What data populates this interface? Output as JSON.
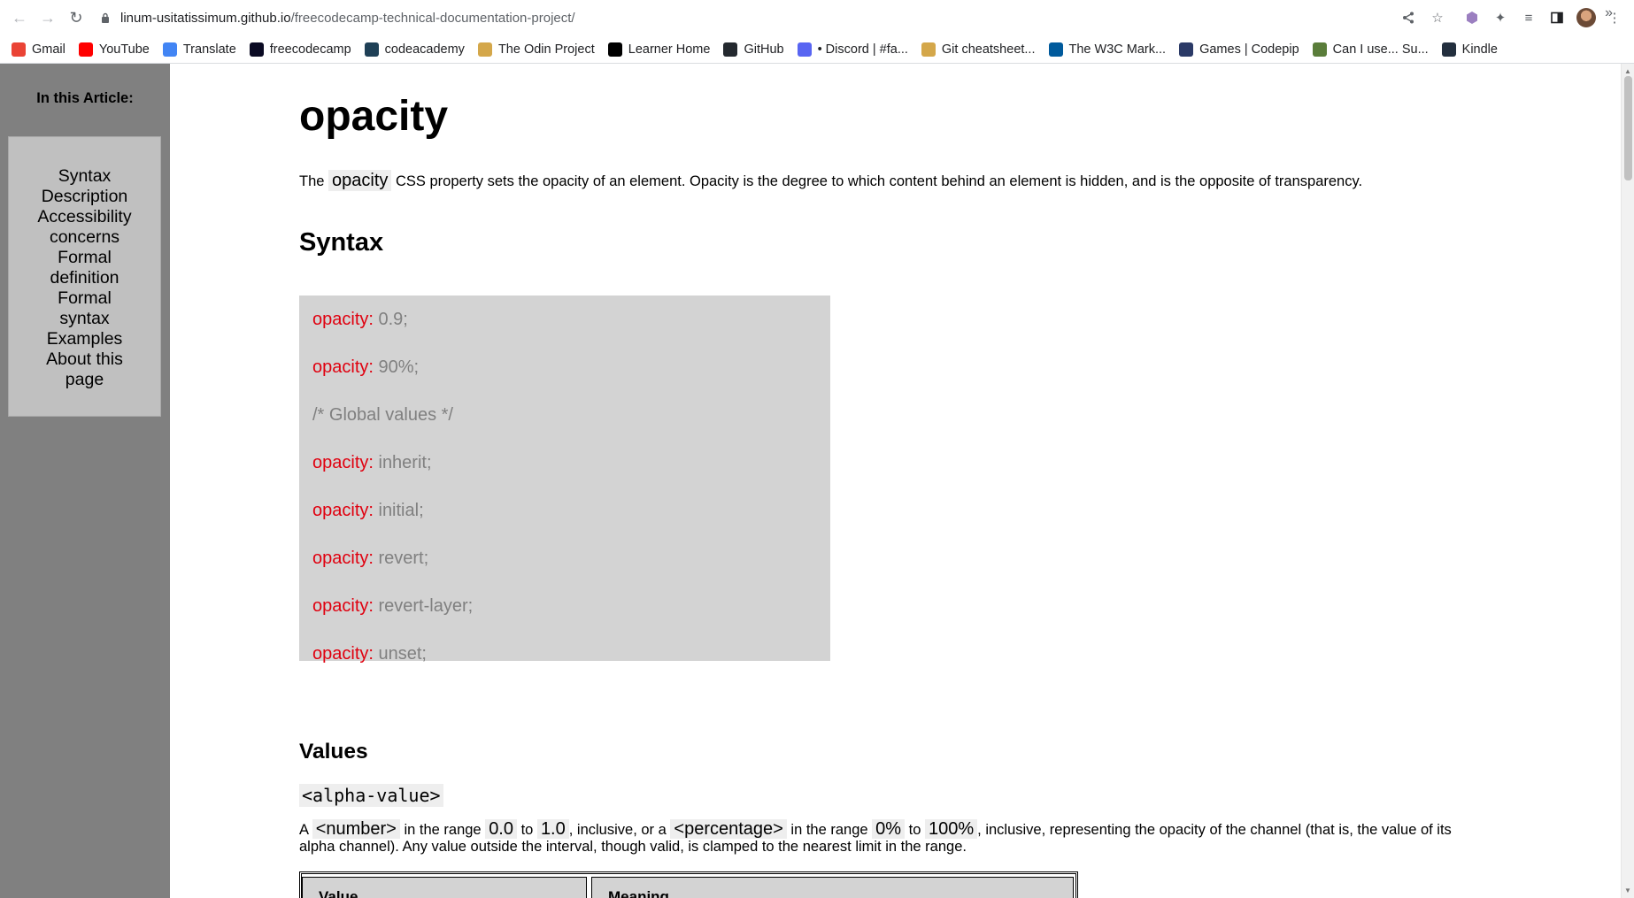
{
  "browser": {
    "url_host": "linum-usitatissimum.github.io",
    "url_path": "/freecodecamp-technical-documentation-project/",
    "bookmarks": [
      {
        "label": "Gmail",
        "color": "#ea4335",
        "icon": "gmail-icon"
      },
      {
        "label": "YouTube",
        "color": "#ff0000",
        "icon": "youtube-icon"
      },
      {
        "label": "Translate",
        "color": "#4285f4",
        "icon": "translate-icon"
      },
      {
        "label": "freecodecamp",
        "color": "#0a0a23",
        "icon": "freecodecamp-icon"
      },
      {
        "label": "codeacademy",
        "color": "#1f4056",
        "icon": "codecademy-icon"
      },
      {
        "label": "The Odin Project",
        "color": "#d4a74a",
        "icon": "odin-icon"
      },
      {
        "label": "Learner Home",
        "color": "#000000",
        "icon": "edx-icon"
      },
      {
        "label": "GitHub",
        "color": "#24292f",
        "icon": "github-icon"
      },
      {
        "label": "• Discord | #fa...",
        "color": "#5865f2",
        "icon": "discord-icon"
      },
      {
        "label": "Git cheatsheet...",
        "color": "#d4a74a",
        "icon": "odin-icon"
      },
      {
        "label": "The W3C Mark...",
        "color": "#005a9c",
        "icon": "w3c-icon"
      },
      {
        "label": "Games | Codepip",
        "color": "#2b3a67",
        "icon": "codepip-icon"
      },
      {
        "label": "Can I use... Su...",
        "color": "#5a7d3a",
        "icon": "caniuse-icon"
      },
      {
        "label": "Kindle",
        "color": "#232f3e",
        "icon": "kindle-icon"
      }
    ],
    "bookmarks_overflow": "»"
  },
  "sidebar": {
    "title": "In this Article:",
    "items": [
      {
        "label": "Syntax"
      },
      {
        "label": "Description"
      },
      {
        "label": "Accessibility concerns"
      },
      {
        "label": "Formal definition"
      },
      {
        "label": "Formal syntax"
      },
      {
        "label": "Examples"
      },
      {
        "label": "About this page"
      }
    ]
  },
  "main": {
    "title": "opacity",
    "intro_before": "The ",
    "intro_code": "opacity",
    "intro_after": " CSS property sets the opacity of an element. Opacity is the degree to which content behind an element is hidden, and is the opposite of transparency.",
    "syntax_heading": "Syntax",
    "code_lines": [
      {
        "prop": "opacity:",
        "val": " 0.9;"
      },
      {
        "prop": "opacity:",
        "val": " 90%;"
      },
      {
        "prop": "",
        "val": "/* Global values */"
      },
      {
        "prop": "opacity:",
        "val": " inherit;"
      },
      {
        "prop": "opacity:",
        "val": " initial;"
      },
      {
        "prop": "opacity:",
        "val": " revert;"
      },
      {
        "prop": "opacity:",
        "val": " revert-layer;"
      },
      {
        "prop": "opacity:",
        "val": " unset;"
      }
    ],
    "values_heading": "Values",
    "alpha_value": "<alpha-value>",
    "alpha_desc": {
      "t1": "A ",
      "c1": "<number>",
      "t2": " in the range ",
      "c2": "0.0",
      "t3": " to ",
      "c3": "1.0",
      "t4": ", inclusive, or a ",
      "c4": "<percentage>",
      "t5": " in the range ",
      "c5": "0%",
      "t6": " to ",
      "c6": "100%",
      "t7": ", inclusive, representing the opacity of the channel (that is, the value of its alpha channel). Any value outside the interval, though valid, is clamped to the nearest limit in the range."
    },
    "table_headers": [
      "Value",
      "Meaning"
    ]
  },
  "colors": {
    "sidebar_bg": "#808080",
    "toc_bg": "#c0c0c0",
    "code_bg": "#d3d3d3",
    "code_prop": "#e0000f",
    "code_val": "#808080"
  }
}
